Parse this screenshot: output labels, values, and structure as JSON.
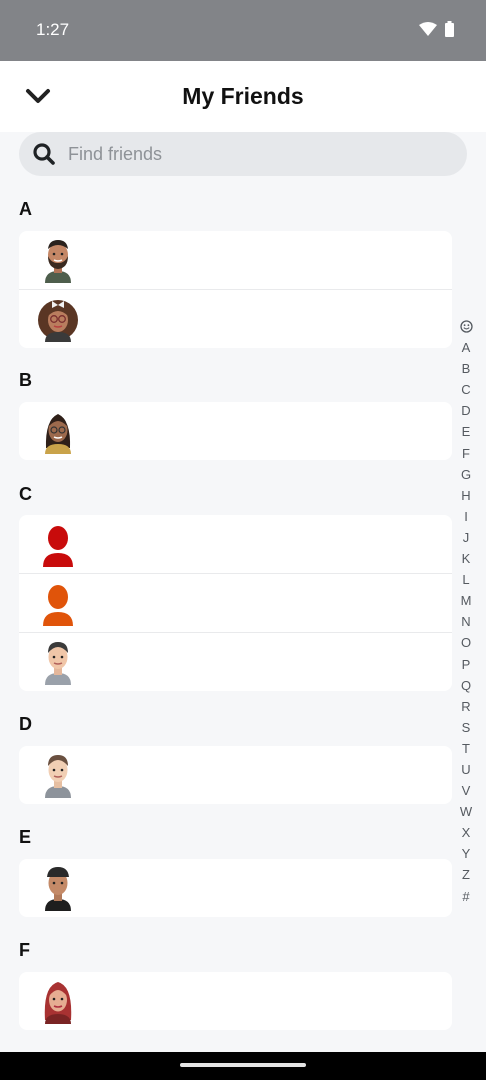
{
  "status_bar": {
    "time": "1:27",
    "wifi_icon": "wifi-icon",
    "battery_icon": "battery-icon"
  },
  "header": {
    "title": "My Friends",
    "back_icon": "chevron-down-icon"
  },
  "search": {
    "placeholder": "Find friends",
    "value": "",
    "icon": "search-icon"
  },
  "sections": [
    {
      "letter": "A",
      "friends": [
        {
          "avatar": "bitmoji-man-beard"
        },
        {
          "avatar": "bitmoji-woman-glasses-bow"
        }
      ]
    },
    {
      "letter": "B",
      "friends": [
        {
          "avatar": "bitmoji-woman-glasses"
        }
      ]
    },
    {
      "letter": "C",
      "friends": [
        {
          "avatar": "silhouette-red"
        },
        {
          "avatar": "silhouette-orange"
        },
        {
          "avatar": "bitmoji-man-grey-shirt"
        }
      ]
    },
    {
      "letter": "D",
      "friends": [
        {
          "avatar": "bitmoji-man-beige"
        }
      ]
    },
    {
      "letter": "E",
      "friends": [
        {
          "avatar": "bitmoji-man-cap"
        }
      ]
    },
    {
      "letter": "F",
      "friends": [
        {
          "avatar": "bitmoji-woman-red-hair"
        }
      ]
    }
  ],
  "index_bar": [
    "A",
    "B",
    "C",
    "D",
    "E",
    "F",
    "G",
    "H",
    "I",
    "J",
    "K",
    "L",
    "M",
    "N",
    "O",
    "P",
    "Q",
    "R",
    "S",
    "T",
    "U",
    "V",
    "W",
    "X",
    "Y",
    "Z",
    "#"
  ],
  "colors": {
    "status_bar": "#828488",
    "background": "#f6f7f9",
    "card": "#ffffff",
    "search_bg": "#e6e8eb"
  }
}
